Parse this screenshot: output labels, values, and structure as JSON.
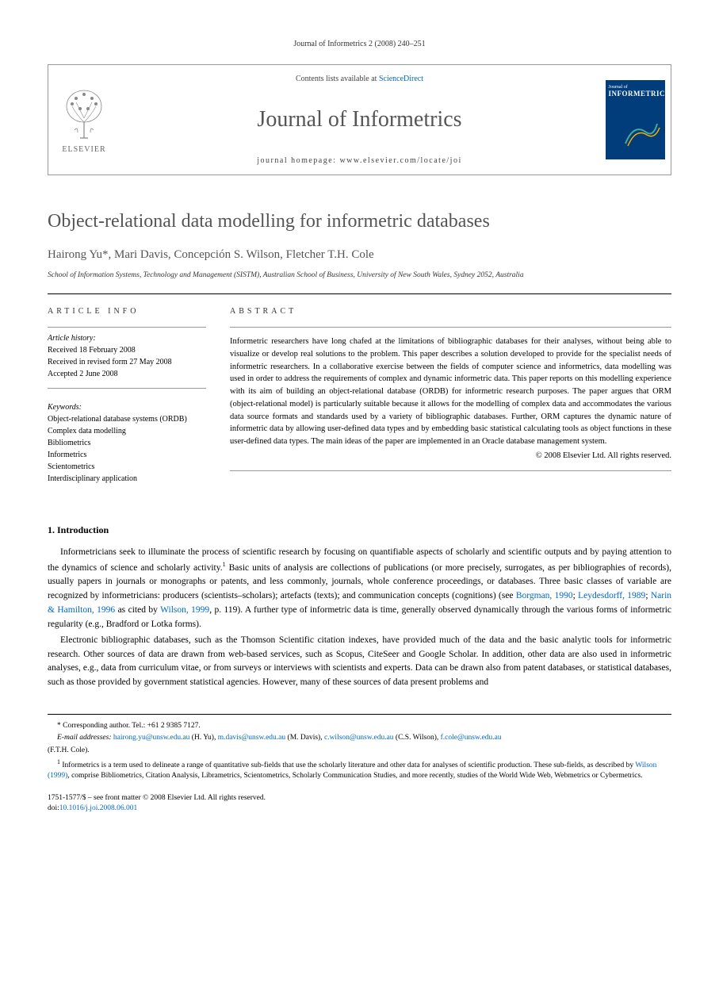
{
  "running_head": "Journal of Informetrics 2 (2008) 240–251",
  "header": {
    "contents_prefix": "Contents lists available at ",
    "sciencedirect": "ScienceDirect",
    "journal_title": "Journal of Informetrics",
    "homepage": "journal homepage: www.elsevier.com/locate/joi",
    "elsevier": "ELSEVIER",
    "cover_journal": "Journal of",
    "cover_informetrics": "INFORMETRICS"
  },
  "article": {
    "title": "Object-relational data modelling for informetric databases",
    "authors": "Hairong Yu*, Mari Davis, Concepción S. Wilson, Fletcher T.H. Cole",
    "affiliation": "School of Information Systems, Technology and Management (SISTM), Australian School of Business, University of New South Wales, Sydney 2052, Australia"
  },
  "info": {
    "heading": "ARTICLE INFO",
    "history_label": "Article history:",
    "received": "Received 18 February 2008",
    "revised": "Received in revised form 27 May 2008",
    "accepted": "Accepted 2 June 2008",
    "keywords_label": "Keywords:",
    "keywords": [
      "Object-relational database systems (ORDB)",
      "Complex data modelling",
      "Bibliometrics",
      "Informetrics",
      "Scientometrics",
      "Interdisciplinary application"
    ]
  },
  "abstract": {
    "heading": "ABSTRACT",
    "text": "Informetric researchers have long chafed at the limitations of bibliographic databases for their analyses, without being able to visualize or develop real solutions to the problem. This paper describes a solution developed to provide for the specialist needs of informetric researchers. In a collaborative exercise between the fields of computer science and informetrics, data modelling was used in order to address the requirements of complex and dynamic informetric data. This paper reports on this modelling experience with its aim of building an object-relational database (ORDB) for informetric research purposes. The paper argues that ORM (object-relational model) is particularly suitable because it allows for the modelling of complex data and accommodates the various data source formats and standards used by a variety of bibliographic databases. Further, ORM captures the dynamic nature of informetric data by allowing user-defined data types and by embedding basic statistical calculating tools as object functions in these user-defined data types. The main ideas of the paper are implemented in an Oracle database management system.",
    "copyright": "© 2008 Elsevier Ltd. All rights reserved."
  },
  "section1": {
    "heading": "1. Introduction",
    "para1_a": "Informetricians seek to illuminate the process of scientific research by focusing on quantifiable aspects of scholarly and scientific outputs and by paying attention to the dynamics of science and scholarly activity.",
    "para1_b": " Basic units of analysis are collections of publications (or more precisely, surrogates, as per bibliographies of records), usually papers in journals or monographs or patents, and less commonly, journals, whole conference proceedings, or databases. Three basic classes of variable are recognized by informetricians: producers (scientists–scholars); artefacts (texts); and communication concepts (cognitions) (see ",
    "ref1": "Borgman, 1990",
    "sep1": "; ",
    "ref2": "Leydesdorff, 1989",
    "sep2": "; ",
    "ref3": "Narin & Hamilton, 1996",
    "sep3": " as cited by ",
    "ref4": "Wilson, 1999",
    "para1_c": ", p. 119). A further type of informetric data is time, generally observed dynamically through the various forms of informetric regularity (e.g., Bradford or Lotka forms).",
    "para2": "Electronic bibliographic databases, such as the Thomson Scientific citation indexes, have provided much of the data and the basic analytic tools for informetric research. Other sources of data are drawn from web-based services, such as Scopus, CiteSeer and Google Scholar. In addition, other data are also used in informetric analyses, e.g., data from curriculum vitae, or from surveys or interviews with scientists and experts. Data can be drawn also from patent databases, or statistical databases, such as those provided by government statistical agencies. However, many of these sources of data present problems and"
  },
  "footnotes": {
    "corr": "* Corresponding author. Tel.: +61 2 9385 7127.",
    "email_label": "E-mail addresses: ",
    "email1": "hairong.yu@unsw.edu.au",
    "name1": " (H. Yu), ",
    "email2": "m.davis@unsw.edu.au",
    "name2": " (M. Davis), ",
    "email3": "c.wilson@unsw.edu.au",
    "name3": " (C.S. Wilson), ",
    "email4": "f.cole@unsw.edu.au",
    "name4": " (F.T.H. Cole).",
    "fn1_a": "Informetrics is a term used to delineate a range of quantitative sub-fields that use the scholarly literature and other data for analyses of scientific production. These sub-fields, as described by ",
    "fn1_ref": "Wilson (1999)",
    "fn1_b": ", comprise Bibliometrics, Citation Analysis, Librametrics, Scientometrics, Scholarly Communication Studies, and more recently, studies of the World Wide Web, Webmetrics or Cybermetrics."
  },
  "bottom": {
    "issn": "1751-1577/$ – see front matter © 2008 Elsevier Ltd. All rights reserved.",
    "doi_label": "doi:",
    "doi": "10.1016/j.joi.2008.06.001"
  }
}
